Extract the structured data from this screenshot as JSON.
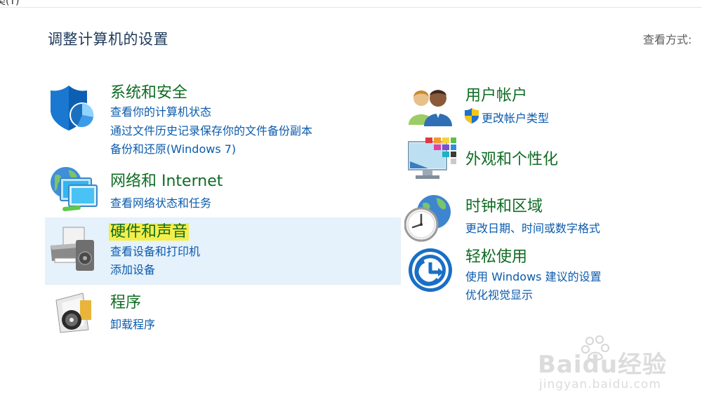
{
  "topbar": {
    "text": "类(T)"
  },
  "page": {
    "title": "调整计算机的设置",
    "view_by_label": "查看方式:"
  },
  "categories_left": [
    {
      "title": "系统和安全",
      "icon": "shield-icon",
      "links": [
        "查看你的计算机状态",
        "通过文件历史记录保存你的文件备份副本",
        "备份和还原(Windows 7)"
      ]
    },
    {
      "title": "网络和 Internet",
      "icon": "network-globe-icon",
      "links": [
        "查看网络状态和任务"
      ]
    },
    {
      "title": "硬件和声音",
      "icon": "printer-speaker-icon",
      "links": [
        "查看设备和打印机",
        "添加设备"
      ]
    },
    {
      "title": "程序",
      "icon": "programs-disc-icon",
      "links": [
        "卸载程序"
      ]
    }
  ],
  "categories_right": [
    {
      "title": "用户帐户",
      "icon": "users-icon",
      "links": [
        "更改帐户类型"
      ],
      "link_icon": "uac-shield-icon"
    },
    {
      "title": "外观和个性化",
      "icon": "monitor-palette-icon",
      "links": []
    },
    {
      "title": "时钟和区域",
      "icon": "clock-globe-icon",
      "links": [
        "更改日期、时间或数字格式"
      ]
    },
    {
      "title": "轻松使用",
      "icon": "ease-of-access-icon",
      "links": [
        "使用 Windows 建议的设置",
        "优化视觉显示"
      ]
    }
  ],
  "watermark": {
    "main": "Baidu经验",
    "sub": "jingyan.baidu.com"
  },
  "colors": {
    "category_title": "#0f6c23",
    "link": "#0b5bad",
    "hover_bg": "#e5f1fb",
    "highlight": "#f5ee4a"
  }
}
